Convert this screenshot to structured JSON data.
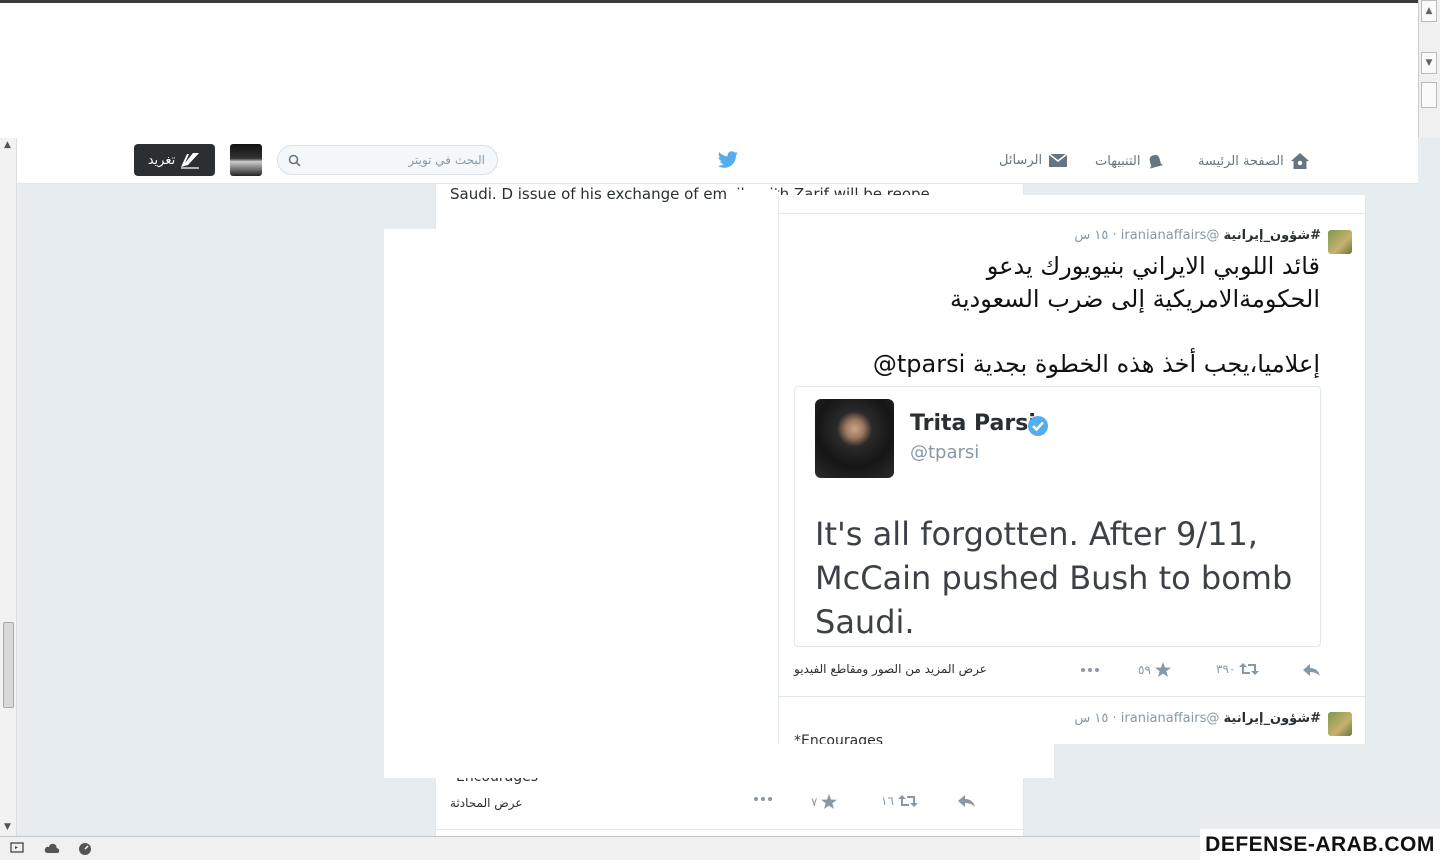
{
  "nav": {
    "home": "الصفحة الرئيسة",
    "notifications": "التنبيهات",
    "messages": "الرسائل",
    "search_placeholder": "البحث في تويتر",
    "tweet_button": "تغريد"
  },
  "back_tweet": {
    "text": "Saudi. D issue of his exchange of emails with Zarif will be reopened",
    "encourages": "Encourages",
    "view_conversation": "عرض المحادثة",
    "retweets": "١٦",
    "likes": "٧"
  },
  "tweet": {
    "name": "#شؤون_إيرانية",
    "handle": "@iranianaffairs",
    "time": "١٥ س",
    "line1": "قائد اللوبي الايراني بنيويورك يدعو",
    "line2": "الحكومةالامريكية إلى ضرب السعودية",
    "line3": "إعلاميا،يجب أخذ هذه الخطوة بجدية",
    "mention": "tparsi@",
    "retweets": "٣٩٠",
    "likes": "٥٩",
    "more_media": "عرض المزيد من الصور ومقاطع الفيديو"
  },
  "quoted": {
    "name": "Trita Parsi",
    "handle": "@tparsi",
    "text_line1": "It's all forgotten. After 9/11,",
    "text_line2": "McCain pushed Bush to bomb",
    "text_line3": "Saudi."
  },
  "tweet2": {
    "name": "#شؤون_إيرانية",
    "handle": "@iranianaffairs",
    "time": "١٥ س",
    "text": "*Encourages"
  },
  "watermark": "DEFENSE-ARAB.COM",
  "colors": {
    "twitter_blue": "#55acee",
    "muted": "#8899a6",
    "verified": "#55acee"
  }
}
